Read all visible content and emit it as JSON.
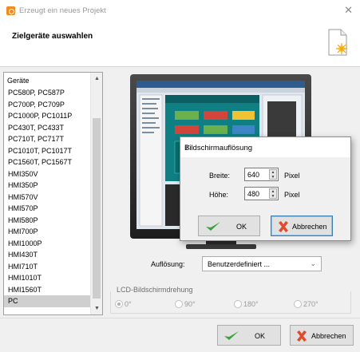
{
  "window": {
    "title": "Erzeugt ein neues Projekt",
    "close_glyph": "✕"
  },
  "header": {
    "title": "Zielgeräte auswahlen"
  },
  "device_list": {
    "header": "Geräte",
    "items": [
      "PC580P, PC587P",
      "PC700P, PC709P",
      "PC1000P, PC1011P",
      "PC430T, PC433T",
      "PC710T, PC717T",
      "PC1010T, PC1017T",
      "PC1560T, PC1567T",
      "HMI350V",
      "HMI350P",
      "HMI570V",
      "HMI570P",
      "HMI580P",
      "HMI700P",
      "HMI1000P",
      "HMI430T",
      "HMI710T",
      "HMI1010T",
      "HMI1560T",
      "PC"
    ],
    "selected": "PC"
  },
  "resolution": {
    "label": "Auflösung:",
    "value": "Benutzerdefiniert ..."
  },
  "lcd_rotation": {
    "label": "LCD-Bildschirmdrehung",
    "options": [
      "0°",
      "90°",
      "180°",
      "270°"
    ],
    "selected": "0°"
  },
  "res_dialog": {
    "title": "Bildschirmauflösung",
    "close_glyph": "✕",
    "width_label": "Breite:",
    "width_value": "640",
    "height_label": "Höhe:",
    "height_value": "480",
    "unit": "Pixel",
    "ok_label": "OK",
    "cancel_label": "Abbrechen"
  },
  "footer": {
    "ok_label": "OK",
    "cancel_label": "Abbrechen"
  },
  "colors": {
    "accent": "#f48a1c",
    "check": "#3aa23a",
    "cancel_x": "#e04b2c"
  }
}
